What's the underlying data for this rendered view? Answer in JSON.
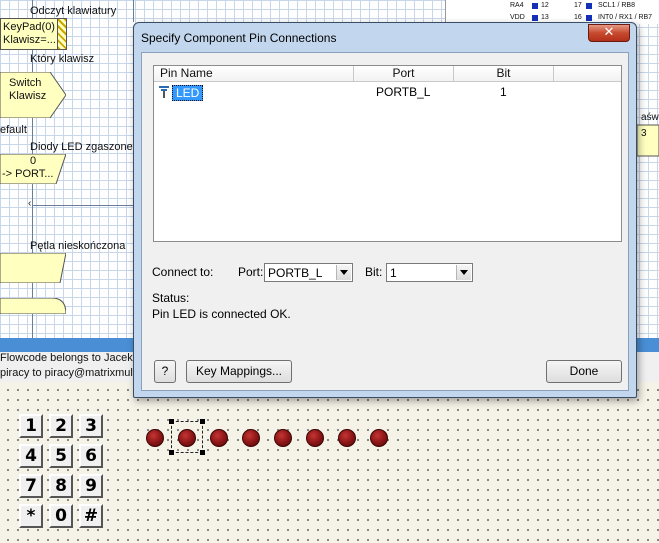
{
  "background": {
    "flowchart": {
      "keypad_box": [
        "KeyPad(0)",
        "Klawisz=..."
      ],
      "odczyt_label": "Odczyt klawiatury",
      "ktory_label": "Który klawisz",
      "switch_box": [
        "Switch",
        "Klawisz"
      ],
      "default_label": "efault",
      "diody_label": "Diody LED zgaszone",
      "port_box": [
        "0",
        "-> PORT..."
      ],
      "petla_label": "Pętla nieskończona",
      "right_labels": [
        "aświ",
        "3"
      ]
    },
    "chip": {
      "rows": [
        {
          "left": "RA4",
          "num_left": "12",
          "num_right": "17",
          "right": "SCL1 / RB8"
        },
        {
          "left": "VDD",
          "num_left": "13",
          "num_right": "16",
          "right": "INT0 / RX1 / RB7"
        }
      ],
      "pin_color": "#1530b8"
    },
    "messages": [
      "Flowcode belongs to Jacek E",
      "piracy to piracy@matrixmulti"
    ]
  },
  "keypad": {
    "keys": [
      "1",
      "2",
      "3",
      "4",
      "5",
      "6",
      "7",
      "8",
      "9",
      "*",
      "0",
      "#"
    ]
  },
  "leds": {
    "count": 8,
    "color": "#8e1616",
    "selected_index": 1
  },
  "dialog": {
    "title": "Specify Component Pin Connections",
    "close_glyph": "✕",
    "list": {
      "columns": [
        "Pin Name",
        "Port",
        "Bit"
      ],
      "rows": [
        {
          "pin": "LED",
          "port": "PORTB_L",
          "bit": "1"
        }
      ]
    },
    "connect_to_label": "Connect to:",
    "port_label": "Port:",
    "port_value": "PORTB_L",
    "bit_label": "Bit:",
    "bit_value": "1",
    "status_label": "Status:",
    "status_text": "Pin LED  is connected OK.",
    "help_label": "?",
    "key_mappings_label": "Key Mappings...",
    "done_label": "Done",
    "accent": "#3399ff"
  }
}
